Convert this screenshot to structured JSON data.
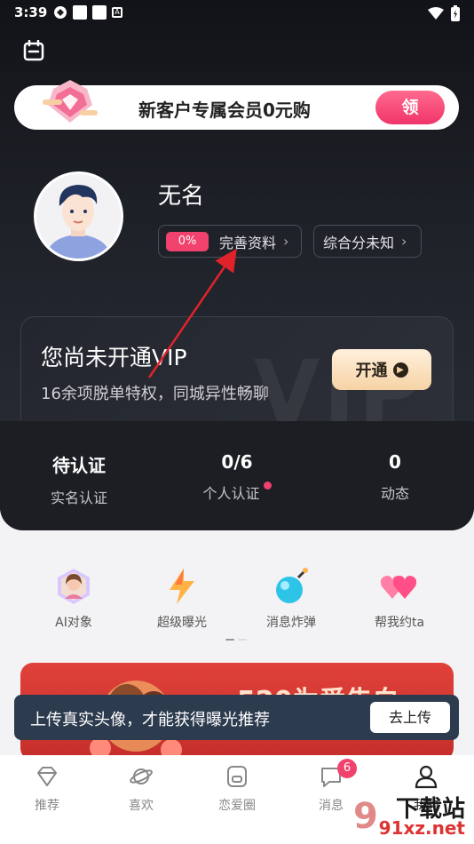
{
  "status_bar": {
    "time": "3:39",
    "small_icon_label": "A"
  },
  "promo": {
    "text": "新客户专属会员0元购",
    "button": "领"
  },
  "profile": {
    "name": "无名",
    "completion_percent": "0%",
    "complete_label": "完善资料",
    "score_label": "综合分未知",
    "chevron": "›"
  },
  "vip": {
    "title": "您尚未开通VIP",
    "subtitle": "16余项脱单特权，同城异性畅聊",
    "button": "开通",
    "watermark": "VIP"
  },
  "stats": [
    {
      "value": "待认证",
      "label": "实名认证"
    },
    {
      "value": "0/6",
      "label": "个人认证"
    },
    {
      "value": "0",
      "label": "动态"
    }
  ],
  "features": [
    {
      "label": "AI对象",
      "icon": "ai-avatar-icon"
    },
    {
      "label": "超级曝光",
      "icon": "lightning-icon"
    },
    {
      "label": "消息炸弹",
      "icon": "bomb-icon"
    },
    {
      "label": "帮我约ta",
      "icon": "hearts-icon"
    }
  ],
  "event_banner": {
    "title": "520为爱告白"
  },
  "toast": {
    "text": "上传真实头像，才能获得曝光推荐",
    "button": "去上传"
  },
  "tabs": [
    {
      "label": "推荐",
      "icon": "diamond-icon"
    },
    {
      "label": "喜欢",
      "icon": "planet-icon"
    },
    {
      "label": "恋爱圈",
      "icon": "circle-icon"
    },
    {
      "label": "消息",
      "icon": "chat-icon",
      "badge": "6"
    },
    {
      "label": "我的",
      "icon": "user-icon",
      "active": true
    }
  ],
  "watermark": {
    "line1": "下载站",
    "line2": "91xz.net"
  },
  "colors": {
    "accent": "#f0426d",
    "vip_gold": "#f6d3a5",
    "dark_bg": "#1c1e24"
  }
}
